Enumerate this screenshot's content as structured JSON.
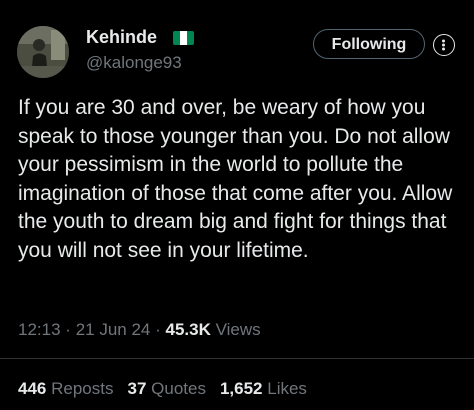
{
  "author": {
    "display_name": "Kehinde",
    "flag_icon": "nigeria-flag-icon",
    "flag_colors": [
      "#008751",
      "#ffffff",
      "#008751"
    ],
    "handle": "@kalonge93"
  },
  "actions": {
    "follow_label": "Following",
    "more_icon": "more-options-icon"
  },
  "tweet": {
    "text": "If you are 30 and over, be weary of how you speak to those younger than you. Do not allow your pessimism in the world to pollute the imagination of those that come after you. Allow the youth to dream big and fight for things that you will not see in your lifetime."
  },
  "meta": {
    "time": "12:13",
    "separator": "·",
    "date": "21 Jun 24",
    "views_count": "45.3K",
    "views_label": "Views"
  },
  "stats": {
    "reposts_count": "446",
    "reposts_label": "Reposts",
    "quotes_count": "37",
    "quotes_label": "Quotes",
    "likes_count": "1,652",
    "likes_label": "Likes"
  },
  "colors": {
    "background": "#000000",
    "primary_text": "#e7e9ea",
    "secondary_text": "#71767b",
    "border": "#536471"
  }
}
